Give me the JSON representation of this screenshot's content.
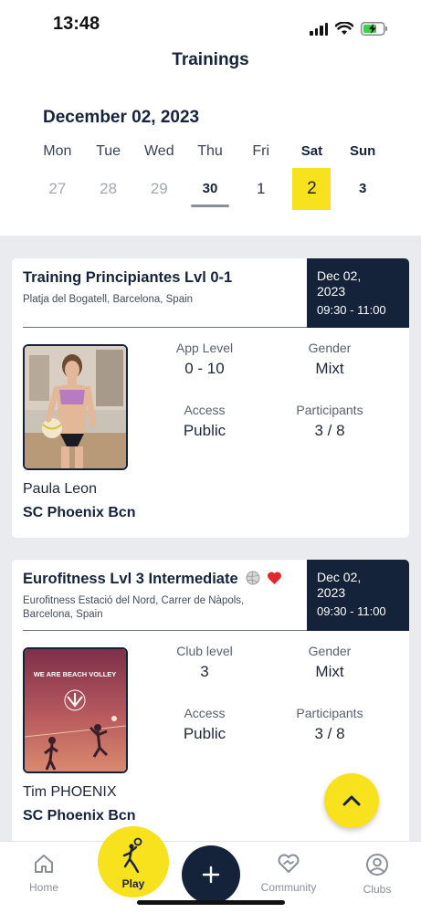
{
  "status": {
    "time": "13:48"
  },
  "header": {
    "title": "Trainings"
  },
  "calendar": {
    "date_title": "December 02, 2023",
    "days": [
      {
        "name": "Mon",
        "num": "27"
      },
      {
        "name": "Tue",
        "num": "28"
      },
      {
        "name": "Wed",
        "num": "29"
      },
      {
        "name": "Thu",
        "num": "30"
      },
      {
        "name": "Fri",
        "num": "1"
      },
      {
        "name": "Sat",
        "num": "2"
      },
      {
        "name": "Sun",
        "num": "3"
      }
    ],
    "selected_day": "2",
    "accent": "#f8e11d"
  },
  "trainings": [
    {
      "title": "Training Principiantes Lvl 0-1",
      "address": "Platja del Bogatell, Barcelona, Spain",
      "date": "Dec 02,",
      "year": "2023",
      "time": "09:30 - 11:00",
      "level_label": "App Level",
      "level_value": "0 - 10",
      "gender_label": "Gender",
      "gender_value": "Mixt",
      "access_label": "Access",
      "access_value": "Public",
      "participants_label": "Participants",
      "participants_value": "3 / 8",
      "coach": "Paula Leon",
      "club": "SC Phoenix Bcn"
    },
    {
      "title": "Eurofitness Lvl 3 Intermediate",
      "title_icons": [
        "volleyball-icon",
        "heart-icon"
      ],
      "address": "Eurofitness Estació del Nord, Carrer de Nàpols, Barcelona, Spain",
      "date": "Dec 02,",
      "year": "2023",
      "time": "09:30 - 11:00",
      "level_label": "Club level",
      "level_value": "3",
      "gender_label": "Gender",
      "gender_value": "Mixt",
      "access_label": "Access",
      "access_value": "Public",
      "participants_label": "Participants",
      "participants_value": "3 / 8",
      "coach": "Tim PHOENIX",
      "club": "SC Phoenix Bcn",
      "photo_text": "WE ARE BEACH VOLLEY"
    }
  ],
  "tabbar": {
    "home": "Home",
    "play": "Play",
    "community": "Community",
    "clubs": "Clubs"
  }
}
